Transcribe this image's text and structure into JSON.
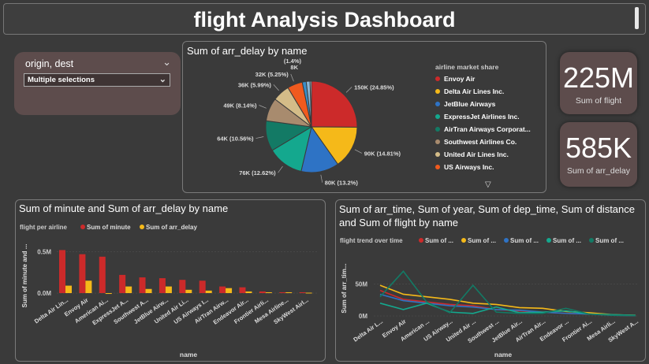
{
  "header": {
    "title": "flight Analysis Dashboard"
  },
  "slicer": {
    "label": "origin, dest",
    "selection": "Multiple selections"
  },
  "kpis": [
    {
      "value": "225M",
      "caption": "Sum of flight"
    },
    {
      "value": "585K",
      "caption": "Sum of arr_delay"
    }
  ],
  "colors": {
    "background": "#3a3a3a",
    "panel": "#5d4c4c",
    "red": "#cc2a2a",
    "yellow": "#f5b919",
    "blue": "#2e73c5",
    "teal": "#14a88e",
    "darkteal": "#137a65"
  },
  "chart_data": [
    {
      "type": "pie",
      "title": "Sum of arr_delay by name",
      "legend_title": "airline market share",
      "legend_position": "right",
      "slices": [
        {
          "name": "Envoy Air",
          "label": "150K (24.85%)",
          "value": 150,
          "percent": 24.85,
          "color": "#cc2a2a"
        },
        {
          "name": "Delta Air Lines Inc.",
          "label": "90K (14.81%)",
          "value": 90,
          "percent": 14.81,
          "color": "#f5b919"
        },
        {
          "name": "JetBlue Airways",
          "label": "80K (13.2%)",
          "value": 80,
          "percent": 13.2,
          "color": "#2e73c5"
        },
        {
          "name": "ExpressJet Airlines Inc.",
          "label": "76K (12.62%)",
          "value": 76,
          "percent": 12.62,
          "color": "#14a88e"
        },
        {
          "name": "AirTran Airways Corporat...",
          "label": "64K (10.56%)",
          "value": 64,
          "percent": 10.56,
          "color": "#137a65"
        },
        {
          "name": "Southwest Airlines Co.",
          "label": "49K (8.14%)",
          "value": 49,
          "percent": 8.14,
          "color": "#a88b6e"
        },
        {
          "name": "United Air Lines Inc.",
          "label": "36K (5.99%)",
          "value": 36,
          "percent": 5.99,
          "color": "#d4bc88"
        },
        {
          "name": "US Airways Inc.",
          "label": "32K (5.25%)",
          "value": 32,
          "percent": 5.25,
          "color": "#f05a1e"
        },
        {
          "name": "",
          "label": "(1.4%)",
          "value": 8.4,
          "percent": 1.4,
          "color": "#3a8ec8"
        },
        {
          "name": "",
          "label": "8K",
          "value": 8,
          "percent": 1.3,
          "color": "#8ab6d6"
        },
        {
          "name": "",
          "label": "",
          "value": 3,
          "percent": 0.5,
          "color": "#b9d7ea"
        }
      ]
    },
    {
      "type": "bar",
      "title": "Sum of minute and Sum of arr_delay by name",
      "legend_title": "flight per airline",
      "xlabel": "name",
      "ylabel": "Sum of minute and ...",
      "ylim": [
        0,
        0.6
      ],
      "yticks": [
        "0.0M",
        "0.5M"
      ],
      "categories": [
        "Delta Air Lin...",
        "Envoy Air",
        "American Ai...",
        "ExpressJet A...",
        "Southwest A...",
        "JetBlue Airw...",
        "United Air Li...",
        "US Airways I...",
        "AirTran Airw...",
        "Endeavor Air...",
        "Frontier Airli...",
        "Mesa Airline...",
        "SkyWest Airl..."
      ],
      "series": [
        {
          "name": "Sum of minute",
          "color": "#cc2a2a",
          "values": [
            0.52,
            0.47,
            0.44,
            0.22,
            0.19,
            0.18,
            0.16,
            0.15,
            0.08,
            0.07,
            0.02,
            0.01,
            0.01
          ]
        },
        {
          "name": "Sum of arr_delay",
          "color": "#f5b919",
          "values": [
            0.09,
            0.15,
            -0.01,
            0.08,
            0.05,
            0.08,
            0.04,
            0.03,
            0.06,
            0.02,
            0.01,
            0.01,
            0.005
          ]
        }
      ]
    },
    {
      "type": "line",
      "title": "Sum of arr_time, Sum of year, Sum of dep_time, Sum of distance and Sum of flight by name",
      "legend_title": "flight trend over time",
      "xlabel": "name",
      "ylabel": "Sum of arr_tim...",
      "ylim": [
        0,
        100
      ],
      "yticks": [
        "0M",
        "50M"
      ],
      "categories": [
        "Delta Air L...",
        "Envoy Air",
        "American ...",
        "US Airway...",
        "United Air ...",
        "Southwest ...",
        "JetBlue Air...",
        "AirTran Air...",
        "Endeavor ...",
        "Frontier Ai...",
        "Mesa Airli...",
        "SkyWest A..."
      ],
      "series": [
        {
          "name": "Sum of ...",
          "color": "#cc2a2a",
          "values": [
            40,
            26,
            22,
            18,
            16,
            10,
            8,
            6,
            4,
            3,
            1,
            0.5
          ]
        },
        {
          "name": "Sum of ...",
          "color": "#f5b919",
          "values": [
            48,
            34,
            30,
            26,
            20,
            18,
            13,
            12,
            7,
            5,
            2,
            1
          ]
        },
        {
          "name": "Sum of ...",
          "color": "#2e73c5",
          "values": [
            34,
            24,
            20,
            16,
            14,
            10,
            9,
            6,
            4,
            3,
            1,
            0.5
          ]
        },
        {
          "name": "Sum of ...",
          "color": "#14a88e",
          "values": [
            20,
            10,
            20,
            6,
            4,
            14,
            5,
            6,
            8,
            3,
            2,
            1
          ]
        },
        {
          "name": "Sum of ...",
          "color": "#137a65",
          "values": [
            30,
            70,
            22,
            5,
            48,
            6,
            4,
            4,
            12,
            3,
            1,
            0.5
          ]
        }
      ]
    }
  ]
}
